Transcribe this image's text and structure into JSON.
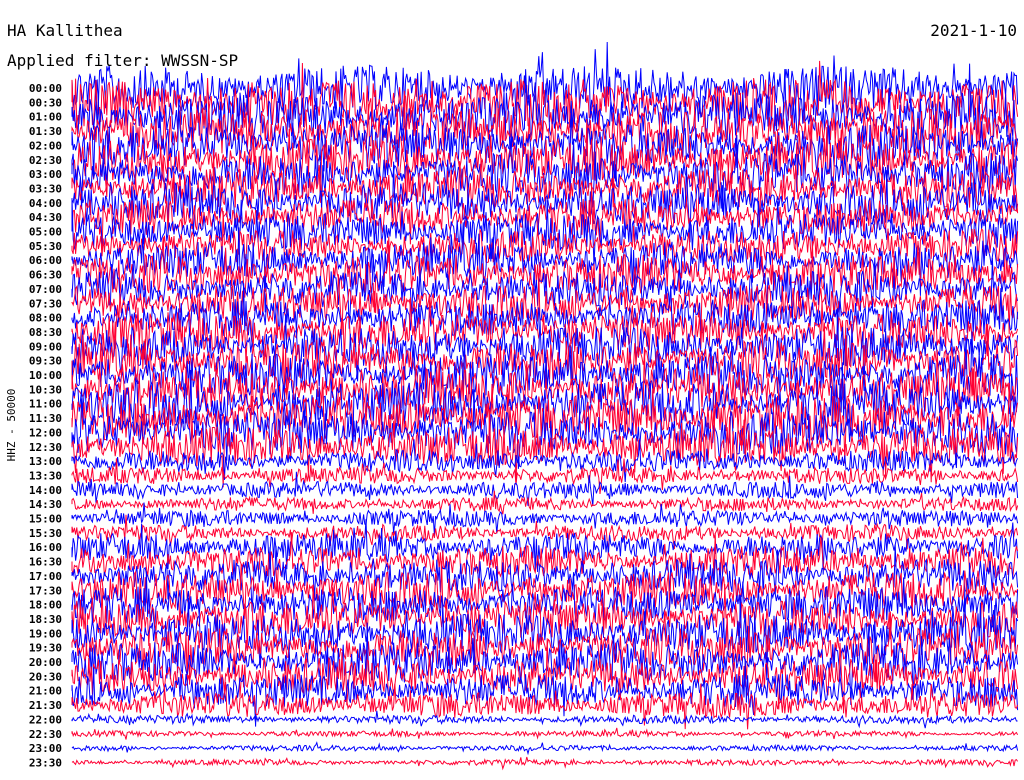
{
  "station_title": "HA Kallithea",
  "date": "2021-1-10",
  "filter_label": "Applied filter: WWSSN-SP",
  "chart_data": {
    "type": "line",
    "title": "HA Kallithea",
    "subtitle": "Applied filter: WWSSN-SP",
    "ylabel": "HHZ - 50000",
    "xlabel": "",
    "row_interval_minutes": 30,
    "row_colors": [
      "#0000ff",
      "#ff0033"
    ],
    "y_tick_labels": [
      "00:00",
      "00:30",
      "01:00",
      "01:30",
      "02:00",
      "02:30",
      "03:00",
      "03:30",
      "04:00",
      "04:30",
      "05:00",
      "05:30",
      "06:00",
      "06:30",
      "07:00",
      "07:30",
      "08:00",
      "08:30",
      "09:00",
      "09:30",
      "10:00",
      "10:30",
      "11:00",
      "11:30",
      "12:00",
      "12:30",
      "13:00",
      "13:30",
      "14:00",
      "14:30",
      "15:00",
      "15:30",
      "16:00",
      "16:30",
      "17:00",
      "17:30",
      "18:00",
      "18:30",
      "19:00",
      "19:30",
      "20:00",
      "20:30",
      "21:00",
      "21:30",
      "22:00",
      "22:30",
      "23:00",
      "23:30"
    ],
    "relative_amplitude": [
      1.6,
      1.7,
      1.7,
      1.6,
      1.6,
      1.5,
      1.5,
      1.4,
      1.4,
      1.3,
      1.3,
      1.2,
      1.3,
      1.4,
      1.3,
      1.3,
      1.3,
      1.4,
      1.4,
      1.5,
      1.5,
      1.5,
      1.6,
      1.6,
      1.6,
      1.4,
      0.8,
      0.6,
      0.6,
      0.5,
      0.6,
      0.6,
      1.0,
      1.1,
      1.2,
      1.3,
      1.3,
      1.4,
      1.4,
      1.4,
      1.4,
      1.3,
      1.2,
      0.9,
      0.3,
      0.2,
      0.2,
      0.2
    ],
    "grid": false,
    "legend": "none"
  }
}
